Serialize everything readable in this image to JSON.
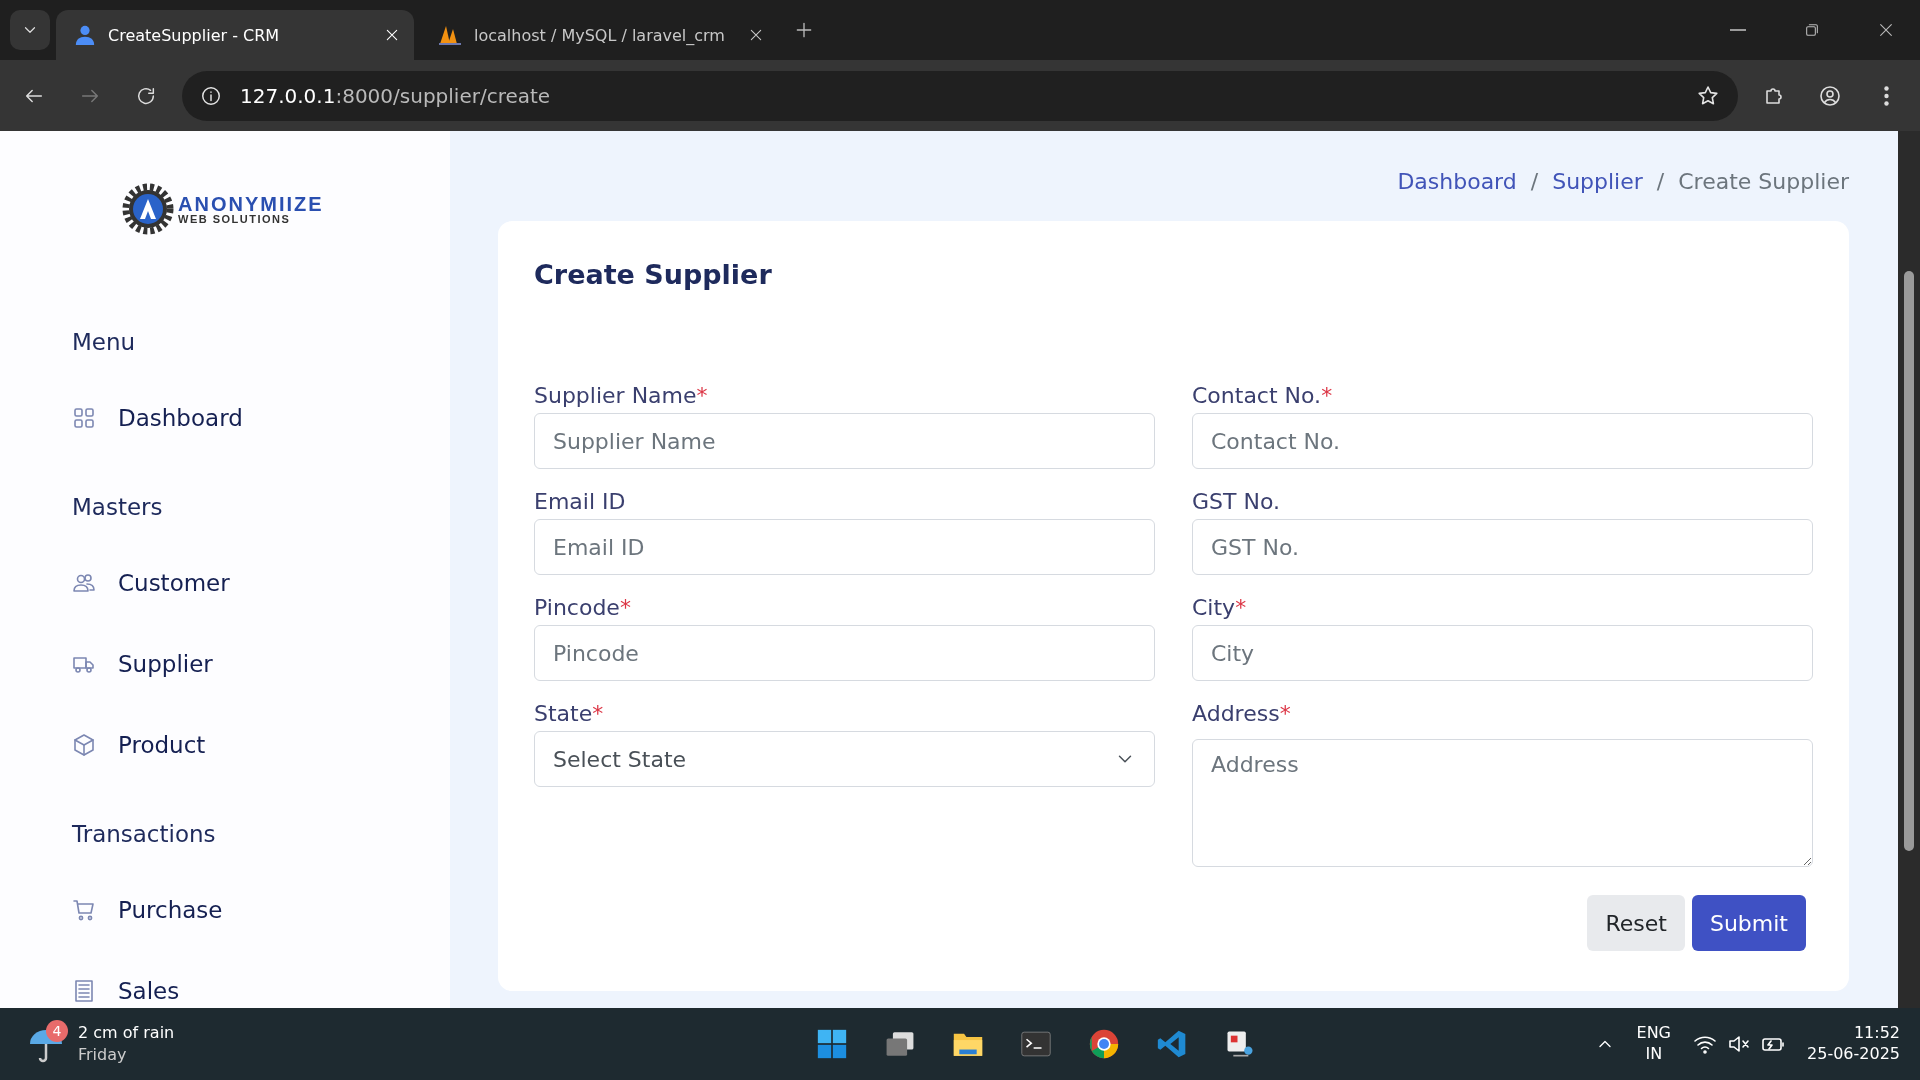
{
  "browser": {
    "tabs": [
      {
        "title": "CreateSupplier - CRM",
        "selected": true
      },
      {
        "title": "localhost / MySQL / laravel_crm",
        "selected": false
      }
    ],
    "url_host": "127.0.0.1",
    "url_path": ":8000/supplier/create"
  },
  "sidebar": {
    "logo": {
      "name": "ANONYMIIZE",
      "tagline": "WEB SOLUTIONS"
    },
    "sections": [
      {
        "heading": "Menu",
        "items": [
          {
            "label": "Dashboard"
          }
        ]
      },
      {
        "heading": "Masters",
        "items": [
          {
            "label": "Customer"
          },
          {
            "label": "Supplier"
          },
          {
            "label": "Product"
          }
        ]
      },
      {
        "heading": "Transactions",
        "items": [
          {
            "label": "Purchase"
          },
          {
            "label": "Sales"
          }
        ]
      }
    ]
  },
  "breadcrumb": {
    "separator": "/",
    "items": [
      {
        "label": "Dashboard",
        "current": false
      },
      {
        "label": "Supplier",
        "current": false
      },
      {
        "label": "Create Supplier",
        "current": true
      }
    ]
  },
  "card": {
    "title": "Create Supplier",
    "fields": [
      {
        "kind": "text",
        "label": "Supplier Name",
        "mark": "*",
        "placeholder": "Supplier Name"
      },
      {
        "kind": "text",
        "label": "Contact No.",
        "mark": "*",
        "placeholder": "Contact No."
      },
      {
        "kind": "text",
        "label": "Email ID",
        "placeholder": "Email ID"
      },
      {
        "kind": "text",
        "label": "GST No.",
        "placeholder": "GST No."
      },
      {
        "kind": "text",
        "label": "Pincode",
        "mark": "*",
        "placeholder": "Pincode"
      },
      {
        "kind": "text",
        "label": "City",
        "mark": "*",
        "placeholder": "City"
      },
      {
        "kind": "select",
        "label": "State",
        "mark": "*",
        "value": "Select State"
      },
      {
        "kind": "textarea",
        "label": "Address",
        "mark": "*",
        "placeholder": "Address"
      }
    ],
    "buttons": [
      {
        "kind": "secondary",
        "label": "Reset"
      },
      {
        "kind": "primary",
        "label": "Submit"
      }
    ]
  },
  "taskbar": {
    "weather": {
      "badge": "4",
      "text": "2 cm of rain",
      "day": "Friday"
    },
    "language": {
      "code": "ENG",
      "region": "IN"
    },
    "clock": {
      "time": "11:52",
      "date": "25-06-2025"
    }
  }
}
